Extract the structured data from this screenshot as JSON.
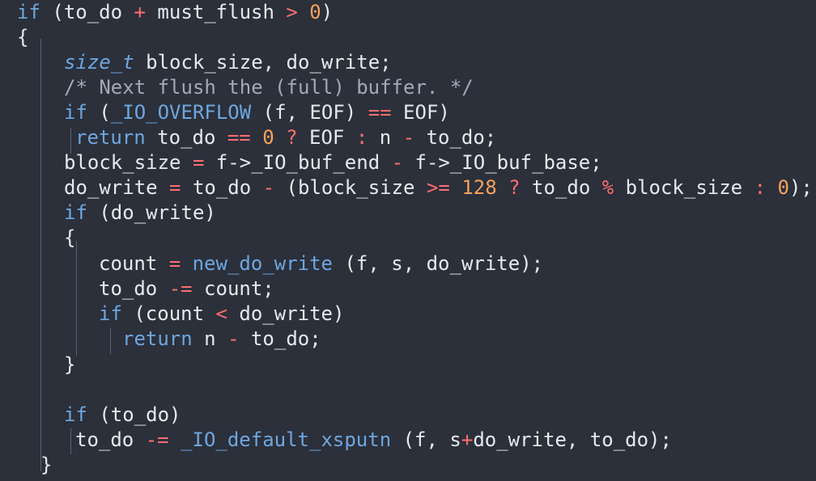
{
  "code": {
    "lines": [
      [
        [
          "kw",
          "if"
        ],
        [
          "pn",
          " ("
        ],
        [
          "id",
          "to_do "
        ],
        [
          "op",
          "+"
        ],
        [
          "id",
          " must_flush "
        ],
        [
          "op",
          ">"
        ],
        [
          "pn",
          " "
        ],
        [
          "num",
          "0"
        ],
        [
          "pn",
          ")"
        ]
      ],
      [
        [
          "pn",
          "{"
        ]
      ],
      [
        [
          "ty",
          "size_t"
        ],
        [
          "id",
          " block_size, do_write;"
        ]
      ],
      [
        [
          "cm",
          "/* Next flush the (full) buffer. */"
        ]
      ],
      [
        [
          "kw",
          "if"
        ],
        [
          "pn",
          " ("
        ],
        [
          "fn",
          "_IO_OVERFLOW"
        ],
        [
          "pn",
          " (f, EOF) "
        ],
        [
          "op",
          "=="
        ],
        [
          "pn",
          " EOF)"
        ]
      ],
      [
        [
          "kw",
          "return"
        ],
        [
          "id",
          " to_do "
        ],
        [
          "op",
          "=="
        ],
        [
          "pn",
          " "
        ],
        [
          "num",
          "0"
        ],
        [
          "pn",
          " "
        ],
        [
          "op",
          "?"
        ],
        [
          "pn",
          " EOF "
        ],
        [
          "op",
          ":"
        ],
        [
          "pn",
          " n "
        ],
        [
          "op",
          "-"
        ],
        [
          "pn",
          " to_do;"
        ]
      ],
      [
        [
          "id",
          "block_size "
        ],
        [
          "op",
          "="
        ],
        [
          "id",
          " f->_IO_buf_end "
        ],
        [
          "op",
          "-"
        ],
        [
          "id",
          " f->_IO_buf_base;"
        ]
      ],
      [
        [
          "id",
          "do_write "
        ],
        [
          "op",
          "="
        ],
        [
          "id",
          " to_do "
        ],
        [
          "op",
          "-"
        ],
        [
          "pn",
          " (block_size "
        ],
        [
          "op",
          ">="
        ],
        [
          "pn",
          " "
        ],
        [
          "num",
          "128"
        ],
        [
          "pn",
          " "
        ],
        [
          "op",
          "?"
        ],
        [
          "pn",
          " to_do "
        ],
        [
          "op",
          "%"
        ],
        [
          "pn",
          " block_size "
        ],
        [
          "op",
          ":"
        ],
        [
          "pn",
          " "
        ],
        [
          "num",
          "0"
        ],
        [
          "pn",
          ");"
        ]
      ],
      [
        [
          "kw",
          "if"
        ],
        [
          "pn",
          " (do_write)"
        ]
      ],
      [
        [
          "pn",
          "{"
        ]
      ],
      [
        [
          "id",
          "count "
        ],
        [
          "op",
          "="
        ],
        [
          "pn",
          " "
        ],
        [
          "fn",
          "new_do_write"
        ],
        [
          "pn",
          " (f, s, do_write);"
        ]
      ],
      [
        [
          "id",
          "to_do "
        ],
        [
          "op",
          "-="
        ],
        [
          "id",
          " count;"
        ]
      ],
      [
        [
          "kw",
          "if"
        ],
        [
          "pn",
          " (count "
        ],
        [
          "op",
          "<"
        ],
        [
          "pn",
          " do_write)"
        ]
      ],
      [
        [
          "kw",
          "return"
        ],
        [
          "id",
          " n "
        ],
        [
          "op",
          "-"
        ],
        [
          "id",
          " to_do;"
        ]
      ],
      [
        [
          "pn",
          "}"
        ]
      ],
      [],
      [
        [
          "kw",
          "if"
        ],
        [
          "pn",
          " (to_do)"
        ]
      ],
      [
        [
          "id",
          "to_do "
        ],
        [
          "op",
          "-="
        ],
        [
          "pn",
          " "
        ],
        [
          "fn",
          "_IO_default_xsputn"
        ],
        [
          "pn",
          " (f, s"
        ],
        [
          "op",
          "+"
        ],
        [
          "pn",
          "do_write, to_do);"
        ]
      ],
      [
        [
          "pn",
          "}"
        ]
      ]
    ]
  }
}
